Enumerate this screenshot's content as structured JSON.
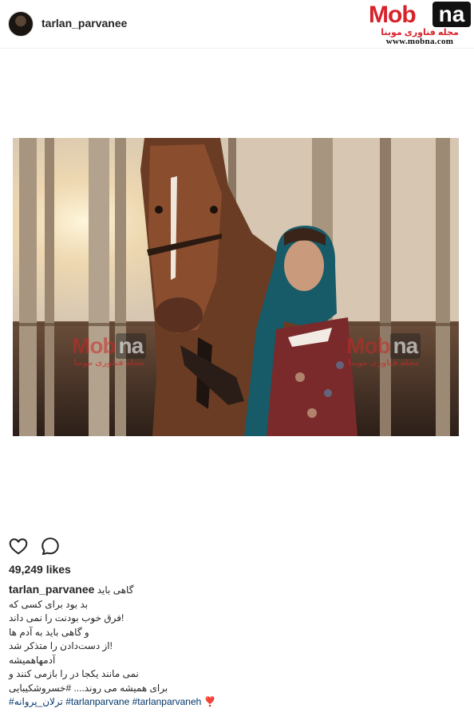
{
  "header": {
    "username": "tarlan_parvanee"
  },
  "logo": {
    "mob": "Mob",
    "na": "na",
    "tagline_fa": "مجله فناوری موبنا",
    "url": "www.mobna.com"
  },
  "watermark": {
    "mob": "Mob",
    "na": "na",
    "tagline_fa": "مجله فناوری موبنا"
  },
  "post": {
    "likes": "49,249 likes",
    "caption": {
      "username": "tarlan_parvanee",
      "first": "گاهی باید",
      "lines": [
        "بد بود برای کسی که",
        "!فرق خوب بودنت را نمی داند",
        "و گاهی باید به آدم ها",
        "!از دست‌دادن را متذکر شد",
        "آدمهاهمیشه",
        "نمی مانند یکجا در را بازمی کنند و",
        "برای همیشه می روند.... #خسروشکیبایی"
      ],
      "tags": {
        "t1": "#ترلان_پروانه",
        "t2": "#tarlanparvane",
        "t3": "#tarlanparvaneh",
        "end": "❣️"
      }
    }
  },
  "icons": {
    "like": "heart-outline-icon",
    "comment": "comment-bubble-icon"
  }
}
